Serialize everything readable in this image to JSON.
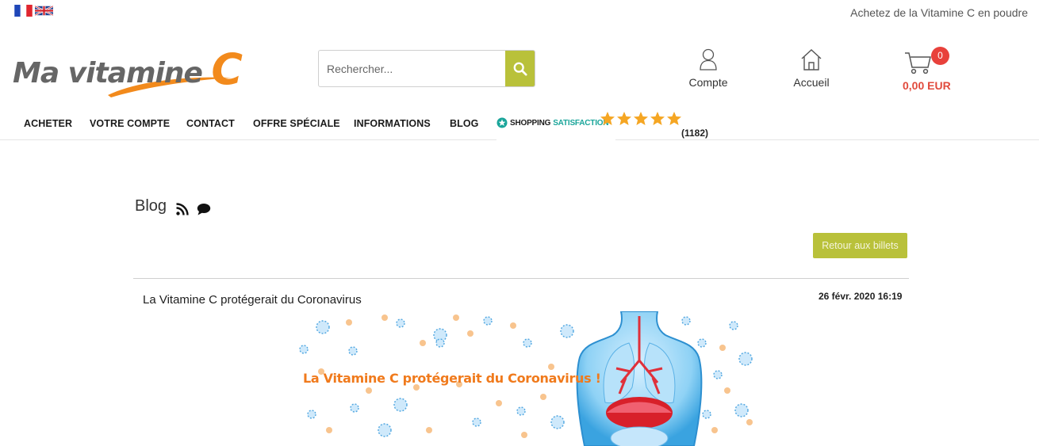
{
  "topbar": {
    "languages": [
      {
        "code": "fr",
        "icon": "flag-fr-icon"
      },
      {
        "code": "en",
        "icon": "flag-uk-icon"
      }
    ],
    "tagline": "Achetez de la Vitamine C en poudre"
  },
  "header": {
    "logo_text": "Ma vitamine",
    "logo_letter": "C",
    "search": {
      "placeholder": "Rechercher...",
      "value": ""
    },
    "account_label": "Compte",
    "home_label": "Accueil",
    "cart": {
      "count": "0",
      "total": "0,00 EUR"
    }
  },
  "nav": {
    "items": [
      "ACHETER",
      "VOTRE COMPTE",
      "CONTACT",
      "OFFRE SPÉCIALE",
      "INFORMATIONS",
      "BLOG"
    ],
    "badge": {
      "brand_a": "SHOPPING",
      "brand_b": "SATISFACTION",
      "stars": 5,
      "count": "(1182)"
    }
  },
  "blog": {
    "title": "Blog",
    "back_button": "Retour aux billets",
    "post": {
      "title": "La Vitamine C protégerait du Coronavirus",
      "date": "26 févr. 2020 16:19",
      "image_caption": "La Vitamine C protégerait du Coronavirus !"
    }
  },
  "colors": {
    "accent_green": "#b9c13a",
    "logo_orange": "#f28a1c",
    "cart_red": "#e14a3c",
    "rating_star": "#f5a623"
  }
}
